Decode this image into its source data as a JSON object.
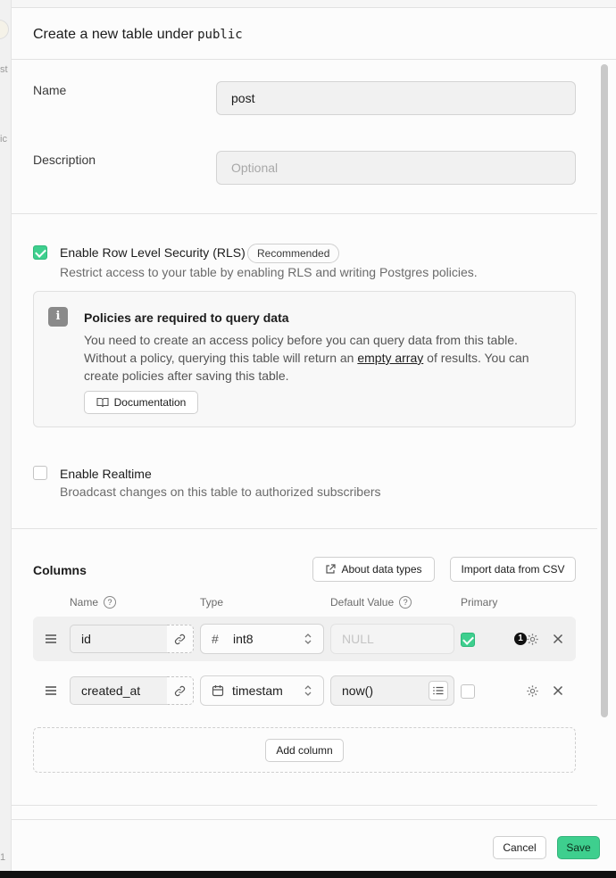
{
  "background": {
    "fragments": [
      "st",
      "ic",
      "1"
    ]
  },
  "header": {
    "title_prefix": "Create a new table under",
    "schema": "public"
  },
  "form": {
    "name_label": "Name",
    "name_value": "post",
    "description_label": "Description",
    "description_placeholder": "Optional"
  },
  "rls": {
    "checked": true,
    "label": "Enable Row Level Security (RLS)",
    "badge": "Recommended",
    "description": "Restrict access to your table by enabling RLS and writing Postgres policies.",
    "alert": {
      "title": "Policies are required to query data",
      "body_part1": "You need to create an access policy before you can query data from this table. Without a policy, querying this table will return an",
      "body_link": "empty array",
      "body_part2": "of results. You can create policies after saving this table.",
      "doc_button": "Documentation"
    }
  },
  "realtime": {
    "checked": false,
    "label": "Enable Realtime",
    "description": "Broadcast changes on this table to authorized subscribers"
  },
  "columns": {
    "title": "Columns",
    "about_button": "About data types",
    "import_button": "Import data from CSV",
    "headers": {
      "name": "Name",
      "type": "Type",
      "default": "Default Value",
      "primary": "Primary"
    },
    "rows": [
      {
        "name": "id",
        "type": "int8",
        "type_icon": "hash-icon",
        "default_value": "",
        "default_placeholder": "NULL",
        "primary": true,
        "badge": "1"
      },
      {
        "name": "created_at",
        "type": "timestam",
        "type_icon": "calendar-icon",
        "default_value": "now()",
        "default_placeholder": "",
        "primary": false,
        "badge": ""
      }
    ],
    "add_button": "Add column"
  },
  "footer": {
    "cancel": "Cancel",
    "save": "Save"
  },
  "colors": {
    "accent": "#3ecf8e",
    "border": "#d4d4d4"
  }
}
